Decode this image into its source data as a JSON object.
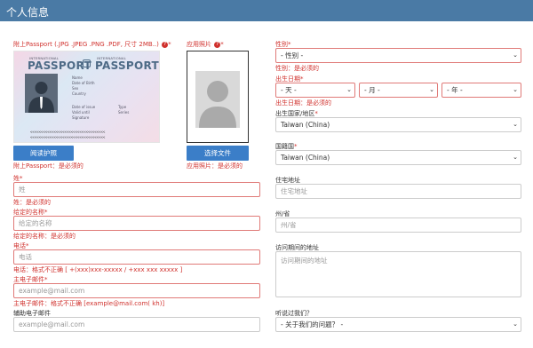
{
  "header": {
    "title": "个人信息"
  },
  "passport": {
    "label": "附上Passport (.JPG .JPEG .PNG .PDF, 尺寸 2MB..)",
    "card": {
      "intl_left": "INTERNATIONAL",
      "word_left": "PASSPORT",
      "intl_right": "INTERNATIONAL",
      "word_right": "PASSPORT",
      "fields": [
        "Name",
        "Date of Birth",
        "Sex",
        "Country"
      ],
      "fields_bottom_left": [
        "Date of issue",
        "Valid until",
        "Signature"
      ],
      "fields_bottom_right": [
        "Type",
        "Series"
      ],
      "mrz1": "<<<<<<<<<<<<<<<<<<<<<<<<<<<<<<<<<<<",
      "mrz2": "<<<<<<<<<<<<<<<<<<<<<<<<<<<<<<<<<<<"
    },
    "button": "阅读护照",
    "error": "附上Passport：是必须的"
  },
  "photo": {
    "label": "应用照片",
    "button": "选择文件",
    "error": "应用照片：是必须的"
  },
  "surname": {
    "label": "姓",
    "placeholder": "姓",
    "error": "姓：是必须的"
  },
  "given_name": {
    "label": "给定的名称",
    "placeholder": "给定的名称",
    "error": "给定的名称：是必须的"
  },
  "phone": {
    "label": "电话",
    "placeholder": "电话",
    "error": "电话：格式不正确 [ +(xxx)xxx-xxxxx / +xxx xxx xxxxx ]"
  },
  "email": {
    "label": "主电子邮件",
    "placeholder": "example@mail.com",
    "error": "主电子邮件：格式不正确 [example@mail.com( kh)]"
  },
  "email2": {
    "label": "辅助电子邮件",
    "placeholder": "example@mail.com"
  },
  "gender": {
    "label": "性别",
    "value": "- 性别 -",
    "error": "性别：是必须的"
  },
  "dob": {
    "label": "出生日期",
    "day": "- 天 -",
    "month": "- 月 -",
    "year": "- 年 -",
    "error": "出生日期：是必须的"
  },
  "birth_country": {
    "label": "出生国家/地区",
    "value": "Taiwan (China)"
  },
  "nationality": {
    "label": "国籍国",
    "value": "Taiwan (China)"
  },
  "address": {
    "label": "住宅地址",
    "placeholder": "住宅地址"
  },
  "state": {
    "label": "州/省",
    "placeholder": "州/省"
  },
  "visit_address": {
    "label": "访问期间的地址",
    "placeholder": "访问期间的地址"
  },
  "referral": {
    "label": "听说过我们？",
    "value": "- 关于我们的问题？ -"
  },
  "symbols": {
    "required": "*",
    "help": "?",
    "chevron": "⌄"
  },
  "colors": {
    "header": "#4a7aa5",
    "button": "#3b7ec8",
    "error": "#d0312d"
  }
}
